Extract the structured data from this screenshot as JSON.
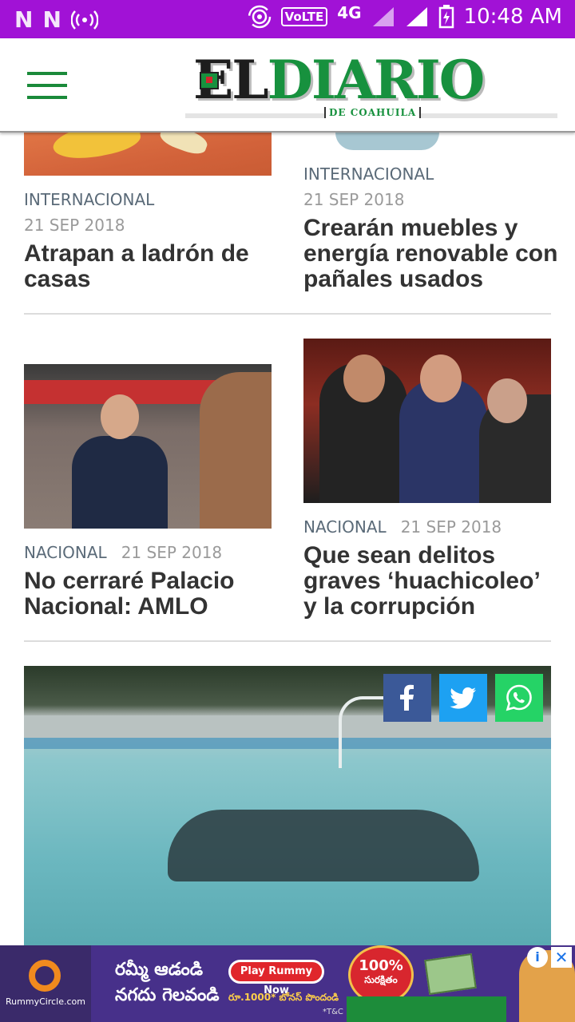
{
  "status_bar": {
    "left_icons": [
      "n-notification-icon",
      "n-notification-icon",
      "hotspot-icon"
    ],
    "volte": "VoLTE",
    "network": "4G",
    "time": "10:48 AM"
  },
  "header": {
    "logo_el": "EL",
    "logo_diario": "DIARIO",
    "logo_sub": "DE COAHUILA"
  },
  "articles": [
    {
      "category": "INTERNACIONAL",
      "date": "21 SEP 2018",
      "title": "Atrapan a ladrón de casas"
    },
    {
      "category": "INTERNACIONAL",
      "date": "21 SEP 2018",
      "title": "Crearán muebles y energía renovable con pañales usados"
    },
    {
      "category": "NACIONAL",
      "date": "21 SEP 2018",
      "title": "No cerraré Palacio Nacional: AMLO"
    },
    {
      "category": "NACIONAL",
      "date": "21 SEP 2018",
      "title": "Que sean delitos graves ‘huachicoleo’ y la corrupción"
    }
  ],
  "share": {
    "facebook_icon": "facebook-icon",
    "twitter_icon": "twitter-icon",
    "whatsapp_icon": "whatsapp-icon"
  },
  "ad": {
    "brand": "RummyCircle.com",
    "line1": "రమ్మీ ఆడండి",
    "line2": "నగదు గెలవండి",
    "button": "Play Rummy Now",
    "prize": "రూ.1000* బోనస్ పొందండి",
    "badge_pct": "100%",
    "badge_text": "సురక్షితం",
    "tc": "*T&C",
    "info": "i",
    "close": "✕"
  },
  "colors": {
    "status_bar": "#a112d6",
    "brand_green": "#17913e",
    "facebook": "#3b5998",
    "twitter": "#1da1f2",
    "whatsapp": "#25d366"
  }
}
